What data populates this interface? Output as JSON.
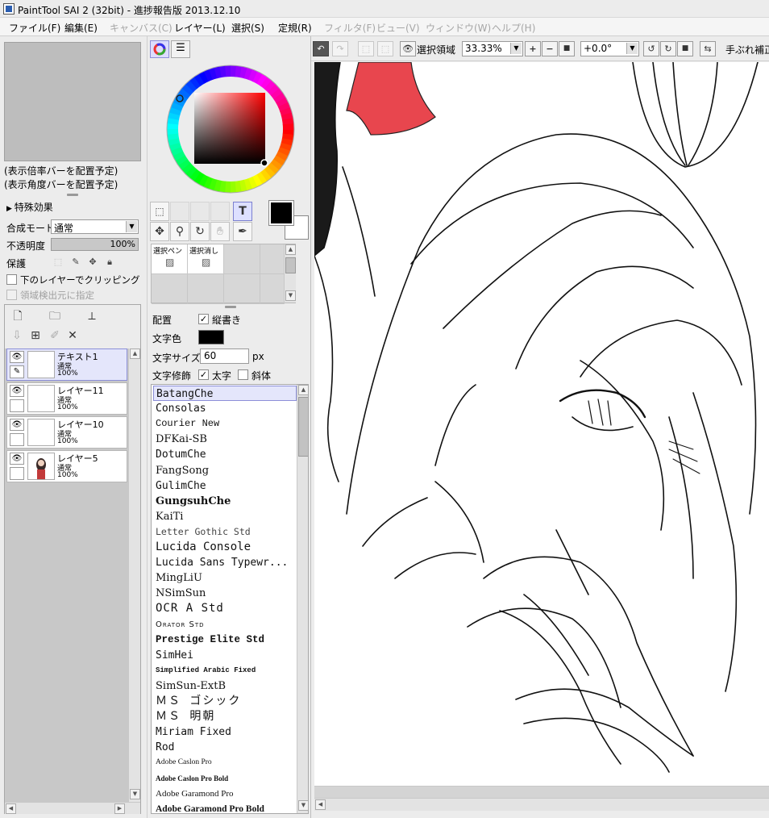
{
  "window": {
    "title": "PaintTool SAI 2 (32bit) - 進捗報告版 2013.12.10"
  },
  "menubar": {
    "items": [
      {
        "label": "ファイル(F)",
        "enabled": true
      },
      {
        "label": "編集(E)",
        "enabled": true
      },
      {
        "label": "キャンバス(C)",
        "enabled": false
      },
      {
        "label": "レイヤー(L)",
        "enabled": true
      },
      {
        "label": "選択(S)",
        "enabled": true
      },
      {
        "label": "定規(R)",
        "enabled": true
      },
      {
        "label": "フィルタ(F)",
        "enabled": false
      },
      {
        "label": "ビュー(V)",
        "enabled": false
      },
      {
        "label": "ウィンドウ(W)",
        "enabled": false
      },
      {
        "label": "ヘルプ(H)",
        "enabled": false
      }
    ]
  },
  "navigator": {
    "zoom_bar_placeholder": "(表示倍率バーを配置予定)",
    "angle_bar_placeholder": "(表示角度バーを配置予定)"
  },
  "layer_props": {
    "effects_label": "特殊効果",
    "blend_mode_label": "合成モード",
    "blend_mode_value": "通常",
    "opacity_label": "不透明度",
    "opacity_value": "100%",
    "opacity_fraction": 1.0,
    "protect_label": "保護",
    "clipping_label": "下のレイヤーでクリッピング",
    "clipping_checked": false,
    "region_source_label": "領域検出元に指定",
    "region_source_checked": false
  },
  "layers": [
    {
      "name": "テキスト1",
      "mode": "通常",
      "opacity": "100%",
      "selected": true,
      "visible": true
    },
    {
      "name": "レイヤー11",
      "mode": "通常",
      "opacity": "100%",
      "selected": false,
      "visible": true
    },
    {
      "name": "レイヤー10",
      "mode": "通常",
      "opacity": "100%",
      "selected": false,
      "visible": true
    },
    {
      "name": "レイヤー5",
      "mode": "通常",
      "opacity": "100%",
      "selected": false,
      "visible": true
    }
  ],
  "colors": {
    "accent_selected_bg": "#e4e6fb",
    "accent_selected_border": "#8c8fd8",
    "primary_color": "#000000",
    "secondary_color": "#ffffff",
    "ribbon_red": "#e8464e"
  },
  "tools": {
    "text_tool_label": "T"
  },
  "brushes": [
    {
      "label": "選択ペン"
    },
    {
      "label": "選択消し"
    }
  ],
  "text_tool": {
    "layout_label": "配置",
    "vertical_label": "縦書き",
    "vertical_checked": true,
    "color_label": "文字色",
    "size_label": "文字サイズ",
    "size_value": "60",
    "size_unit": "px",
    "decoration_label": "文字修飾",
    "bold_label": "太字",
    "bold_checked": true,
    "italic_label": "斜体",
    "italic_checked": false
  },
  "font_list": {
    "selected": "BatangChe",
    "items": [
      "BatangChe",
      "Consolas",
      "Courier New",
      "DFKai-SB",
      "DotumChe",
      "FangSong",
      "GulimChe",
      "GungsuhChe",
      "KaiTi",
      "Letter Gothic Std",
      "Lucida Console",
      "Lucida Sans Typewr...",
      "MingLiU",
      "NSimSun",
      "OCR A Std",
      "Orator Std",
      "Prestige Elite Std",
      "SimHei",
      "Simplified Arabic Fixed",
      "SimSun-ExtB",
      "ＭＳ ゴシック",
      "ＭＳ 明朝",
      "Miriam Fixed",
      "Rod",
      "Adobe Caslon Pro",
      "Adobe Caslon Pro Bold",
      "Adobe Garamond Pro",
      "Adobe Garamond Pro Bold"
    ]
  },
  "canvas_toolbar": {
    "selection_area_label": "選択領域",
    "zoom_value": "33.33%",
    "rotation_value": "+0.0°",
    "stabilizer_label": "手ぶれ補正"
  }
}
